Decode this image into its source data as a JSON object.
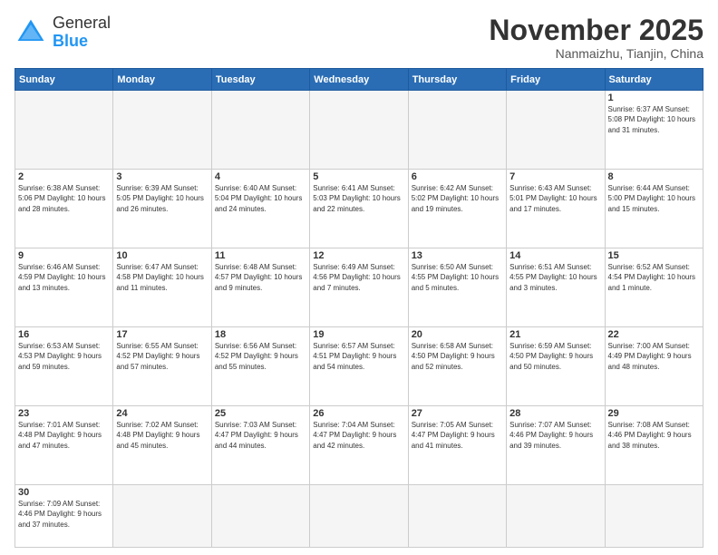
{
  "header": {
    "logo": {
      "general": "General",
      "blue": "Blue"
    },
    "title": "November 2025",
    "location": "Nanmaizhu, Tianjin, China"
  },
  "weekdays": [
    "Sunday",
    "Monday",
    "Tuesday",
    "Wednesday",
    "Thursday",
    "Friday",
    "Saturday"
  ],
  "weeks": [
    [
      {
        "day": "",
        "info": "",
        "empty": true
      },
      {
        "day": "",
        "info": "",
        "empty": true
      },
      {
        "day": "",
        "info": "",
        "empty": true
      },
      {
        "day": "",
        "info": "",
        "empty": true
      },
      {
        "day": "",
        "info": "",
        "empty": true
      },
      {
        "day": "",
        "info": "",
        "empty": true
      },
      {
        "day": "1",
        "info": "Sunrise: 6:37 AM\nSunset: 5:08 PM\nDaylight: 10 hours and 31 minutes."
      }
    ],
    [
      {
        "day": "2",
        "info": "Sunrise: 6:38 AM\nSunset: 5:06 PM\nDaylight: 10 hours and 28 minutes."
      },
      {
        "day": "3",
        "info": "Sunrise: 6:39 AM\nSunset: 5:05 PM\nDaylight: 10 hours and 26 minutes."
      },
      {
        "day": "4",
        "info": "Sunrise: 6:40 AM\nSunset: 5:04 PM\nDaylight: 10 hours and 24 minutes."
      },
      {
        "day": "5",
        "info": "Sunrise: 6:41 AM\nSunset: 5:03 PM\nDaylight: 10 hours and 22 minutes."
      },
      {
        "day": "6",
        "info": "Sunrise: 6:42 AM\nSunset: 5:02 PM\nDaylight: 10 hours and 19 minutes."
      },
      {
        "day": "7",
        "info": "Sunrise: 6:43 AM\nSunset: 5:01 PM\nDaylight: 10 hours and 17 minutes."
      },
      {
        "day": "8",
        "info": "Sunrise: 6:44 AM\nSunset: 5:00 PM\nDaylight: 10 hours and 15 minutes."
      }
    ],
    [
      {
        "day": "9",
        "info": "Sunrise: 6:46 AM\nSunset: 4:59 PM\nDaylight: 10 hours and 13 minutes."
      },
      {
        "day": "10",
        "info": "Sunrise: 6:47 AM\nSunset: 4:58 PM\nDaylight: 10 hours and 11 minutes."
      },
      {
        "day": "11",
        "info": "Sunrise: 6:48 AM\nSunset: 4:57 PM\nDaylight: 10 hours and 9 minutes."
      },
      {
        "day": "12",
        "info": "Sunrise: 6:49 AM\nSunset: 4:56 PM\nDaylight: 10 hours and 7 minutes."
      },
      {
        "day": "13",
        "info": "Sunrise: 6:50 AM\nSunset: 4:55 PM\nDaylight: 10 hours and 5 minutes."
      },
      {
        "day": "14",
        "info": "Sunrise: 6:51 AM\nSunset: 4:55 PM\nDaylight: 10 hours and 3 minutes."
      },
      {
        "day": "15",
        "info": "Sunrise: 6:52 AM\nSunset: 4:54 PM\nDaylight: 10 hours and 1 minute."
      }
    ],
    [
      {
        "day": "16",
        "info": "Sunrise: 6:53 AM\nSunset: 4:53 PM\nDaylight: 9 hours and 59 minutes."
      },
      {
        "day": "17",
        "info": "Sunrise: 6:55 AM\nSunset: 4:52 PM\nDaylight: 9 hours and 57 minutes."
      },
      {
        "day": "18",
        "info": "Sunrise: 6:56 AM\nSunset: 4:52 PM\nDaylight: 9 hours and 55 minutes."
      },
      {
        "day": "19",
        "info": "Sunrise: 6:57 AM\nSunset: 4:51 PM\nDaylight: 9 hours and 54 minutes."
      },
      {
        "day": "20",
        "info": "Sunrise: 6:58 AM\nSunset: 4:50 PM\nDaylight: 9 hours and 52 minutes."
      },
      {
        "day": "21",
        "info": "Sunrise: 6:59 AM\nSunset: 4:50 PM\nDaylight: 9 hours and 50 minutes."
      },
      {
        "day": "22",
        "info": "Sunrise: 7:00 AM\nSunset: 4:49 PM\nDaylight: 9 hours and 48 minutes."
      }
    ],
    [
      {
        "day": "23",
        "info": "Sunrise: 7:01 AM\nSunset: 4:48 PM\nDaylight: 9 hours and 47 minutes."
      },
      {
        "day": "24",
        "info": "Sunrise: 7:02 AM\nSunset: 4:48 PM\nDaylight: 9 hours and 45 minutes."
      },
      {
        "day": "25",
        "info": "Sunrise: 7:03 AM\nSunset: 4:47 PM\nDaylight: 9 hours and 44 minutes."
      },
      {
        "day": "26",
        "info": "Sunrise: 7:04 AM\nSunset: 4:47 PM\nDaylight: 9 hours and 42 minutes."
      },
      {
        "day": "27",
        "info": "Sunrise: 7:05 AM\nSunset: 4:47 PM\nDaylight: 9 hours and 41 minutes."
      },
      {
        "day": "28",
        "info": "Sunrise: 7:07 AM\nSunset: 4:46 PM\nDaylight: 9 hours and 39 minutes."
      },
      {
        "day": "29",
        "info": "Sunrise: 7:08 AM\nSunset: 4:46 PM\nDaylight: 9 hours and 38 minutes."
      }
    ],
    [
      {
        "day": "30",
        "info": "Sunrise: 7:09 AM\nSunset: 4:46 PM\nDaylight: 9 hours and 37 minutes."
      },
      {
        "day": "",
        "info": "",
        "empty": true
      },
      {
        "day": "",
        "info": "",
        "empty": true
      },
      {
        "day": "",
        "info": "",
        "empty": true
      },
      {
        "day": "",
        "info": "",
        "empty": true
      },
      {
        "day": "",
        "info": "",
        "empty": true
      },
      {
        "day": "",
        "info": "",
        "empty": true
      }
    ]
  ]
}
